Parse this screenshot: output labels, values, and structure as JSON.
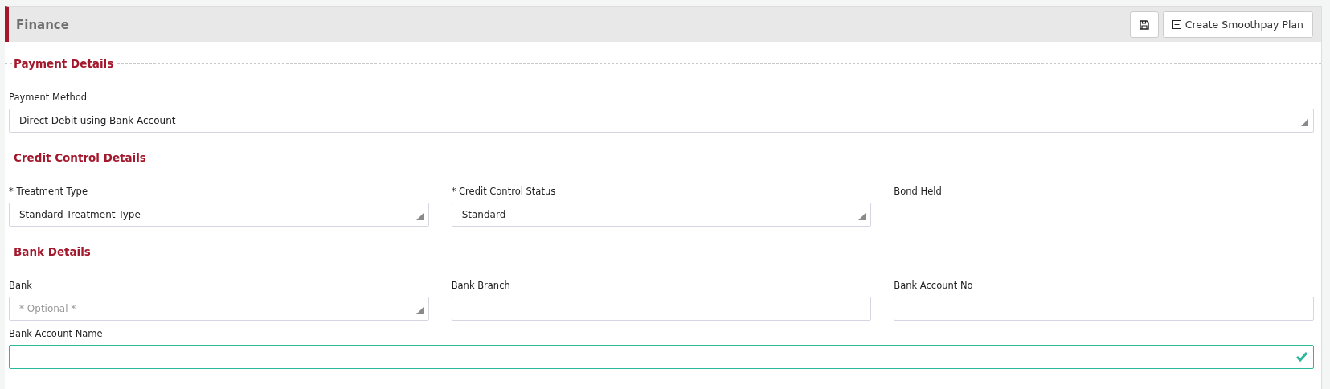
{
  "panel": {
    "title": "Finance",
    "buttons": [
      {
        "kind": "icon"
      },
      {
        "kind": "text",
        "label": "Create Smoothpay Plan"
      }
    ]
  },
  "sections": [
    {
      "title": "Payment Details",
      "rows": [
        [
          {
            "label": "Payment Method",
            "kind": "select",
            "value": "Direct Debit using Bank Account"
          }
        ]
      ]
    },
    {
      "title": "Credit Control Details",
      "rows": [
        [
          {
            "label": "* Treatment Type",
            "kind": "select",
            "value": "Standard Treatment Type"
          },
          {
            "label": "* Credit Control Status",
            "kind": "select",
            "value": "Standard"
          },
          {
            "label": "Bond Held",
            "kind": "none"
          }
        ]
      ]
    },
    {
      "title": "Bank Details",
      "rows": [
        [
          {
            "label": "Bank",
            "kind": "select",
            "placeholder": "* Optional *"
          },
          {
            "label": "Bank Branch",
            "kind": "text"
          },
          {
            "label": "Bank Account No",
            "kind": "text"
          }
        ],
        [
          {
            "label": "Bank Account Name",
            "kind": "text",
            "valid": true
          }
        ]
      ]
    }
  ]
}
